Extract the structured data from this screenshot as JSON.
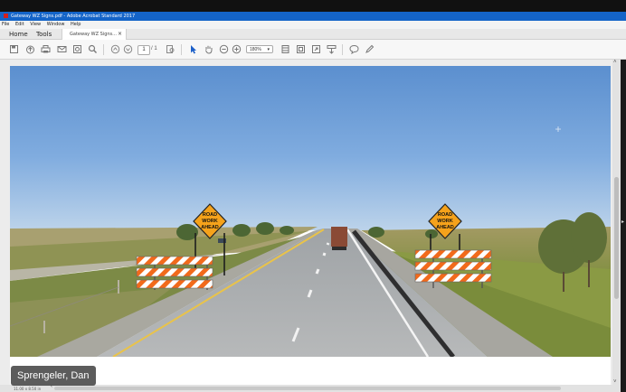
{
  "window": {
    "title": "Gateway WZ Signs.pdf - Adobe Acrobat Standard 2017"
  },
  "menu": [
    "File",
    "Edit",
    "View",
    "Window",
    "Help"
  ],
  "tabs": {
    "home": "Home",
    "tools": "Tools",
    "document": "Gateway WZ Signs...",
    "close": "×"
  },
  "toolbar": {
    "page_current": "1",
    "page_total": "/ 1",
    "zoom": "180%"
  },
  "document": {
    "signs": [
      {
        "text_line1": "ROAD",
        "text_line2": "WORK",
        "text_line3": "AHEAD"
      },
      {
        "text_line1": "ROAD",
        "text_line2": "WORK",
        "text_line3": "AHEAD"
      }
    ]
  },
  "statusbar": {
    "dimensions": "11.00 x 8.50 in"
  },
  "participant": {
    "name": "Sprengeler, Dan"
  },
  "colors": {
    "titlebar": "#1464c8",
    "sign_orange": "#f5a21b",
    "barricade_orange": "#f26a1b"
  },
  "icons": [
    "save-icon",
    "upload-icon",
    "print-icon",
    "email-icon",
    "scan-icon",
    "search-icon",
    "prev-page-icon",
    "next-page-icon",
    "page-find-icon",
    "select-arrow-icon",
    "hand-icon",
    "zoom-out-icon",
    "zoom-in-icon",
    "fit-page-icon",
    "rotate-icon",
    "fullscreen-icon",
    "stamp-icon",
    "comment-icon",
    "pen-icon"
  ]
}
